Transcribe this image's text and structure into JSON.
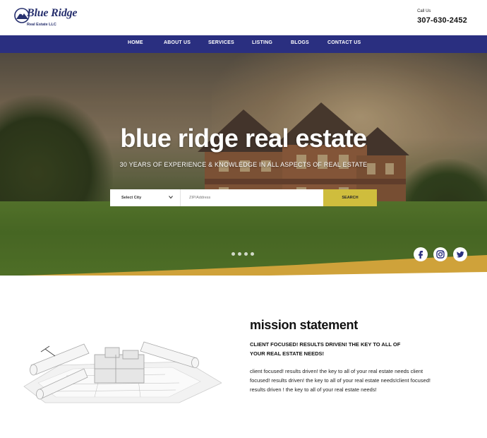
{
  "brand": {
    "name": "Blue Ridge",
    "subtitle": "Real Estate LLC",
    "navy": "#2a2f80",
    "accent_yellow": "#cfbd3d"
  },
  "header": {
    "call_label": "Call Us",
    "phone": "307-630-2452"
  },
  "nav": {
    "items": [
      {
        "label": "HOME"
      },
      {
        "label": "ABOUT US"
      },
      {
        "label": "SERVICES"
      },
      {
        "label": "LISTING"
      },
      {
        "label": "BLOGS"
      },
      {
        "label": "CONTACT US"
      }
    ]
  },
  "hero": {
    "title": "blue ridge real estate",
    "subtitle": "30 YEARS OF EXPERIENCE & KNOWLEDGE IN ALL ASPECTS OF REAL ESTATE",
    "search": {
      "city_select": "Select City",
      "input_placeholder": "ZIP/Address",
      "button": "SEARCH"
    },
    "slide_count": 4,
    "social": [
      {
        "icon": "facebook-icon"
      },
      {
        "icon": "instagram-icon"
      },
      {
        "icon": "twitter-icon"
      }
    ]
  },
  "mission": {
    "title": "mission statement",
    "tagline": "CLIENT FOCUSED! RESULTS DRIVEN! THE KEY TO ALL OF YOUR REAL ESTATE NEEDS!",
    "body": "client focused! results driven! the key to all of your real  estate needs client focused! results driven! the key to all of your real estate needs!client focused! results driven ! the key to all of your real estate needs!"
  }
}
